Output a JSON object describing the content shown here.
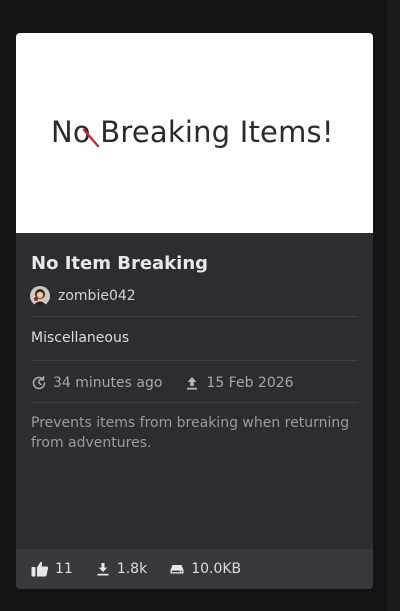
{
  "thumbnail": {
    "text": "No Breaking Items!"
  },
  "mod": {
    "title": "No Item Breaking",
    "author": "zombie042",
    "category": "Miscellaneous",
    "updated": "34 minutes ago",
    "uploaded": "15 Feb 2026",
    "description": "Prevents items from breaking when returning from adventures."
  },
  "stats": {
    "endorsements": "11",
    "downloads": "1.8k",
    "size": "10.0KB"
  },
  "icons": {
    "updated": "refresh-clock-icon",
    "uploaded": "upload-icon",
    "endorsements": "thumbs-up-icon",
    "downloads": "download-icon",
    "size": "hard-drive-icon"
  },
  "colors": {
    "background": "#141416",
    "card": "#2c2c31",
    "stats_bar": "#38383e",
    "thumbnail_strike": "#e02020"
  }
}
